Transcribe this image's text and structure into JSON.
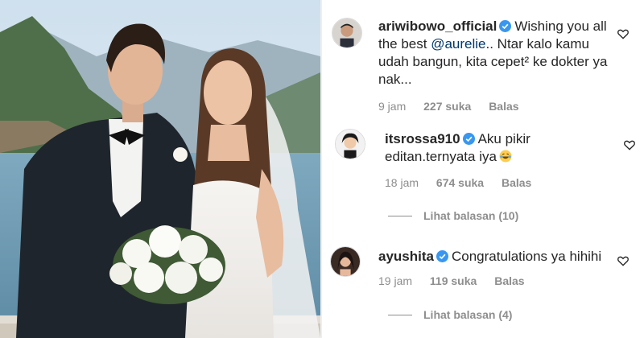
{
  "comments": [
    {
      "username": "ariwibowo_official",
      "mention": "@aurelie",
      "text_before": "Wishing you all the best ",
      "text_after": ".. Ntar kalo kamu udah bangun, kita cepet² ke dokter ya nak...",
      "time": "9 jam",
      "likes": "227 suka",
      "reply": "Balas"
    },
    {
      "username": "itsrossa910",
      "text": "Aku pikir editan.ternyata iya",
      "emoji": "laughing-emoji",
      "time": "18 jam",
      "likes": "674 suka",
      "reply": "Balas",
      "view_replies": "Lihat balasan (10)"
    },
    {
      "username": "ayushita",
      "text": "Congratulations ya hihihi",
      "time": "19 jam",
      "likes": "119 suka",
      "reply": "Balas",
      "view_replies": "Lihat balasan (4)"
    }
  ],
  "colors": {
    "verified": "#3897f0",
    "mention": "#00376b",
    "meta": "#8e8e8e"
  }
}
